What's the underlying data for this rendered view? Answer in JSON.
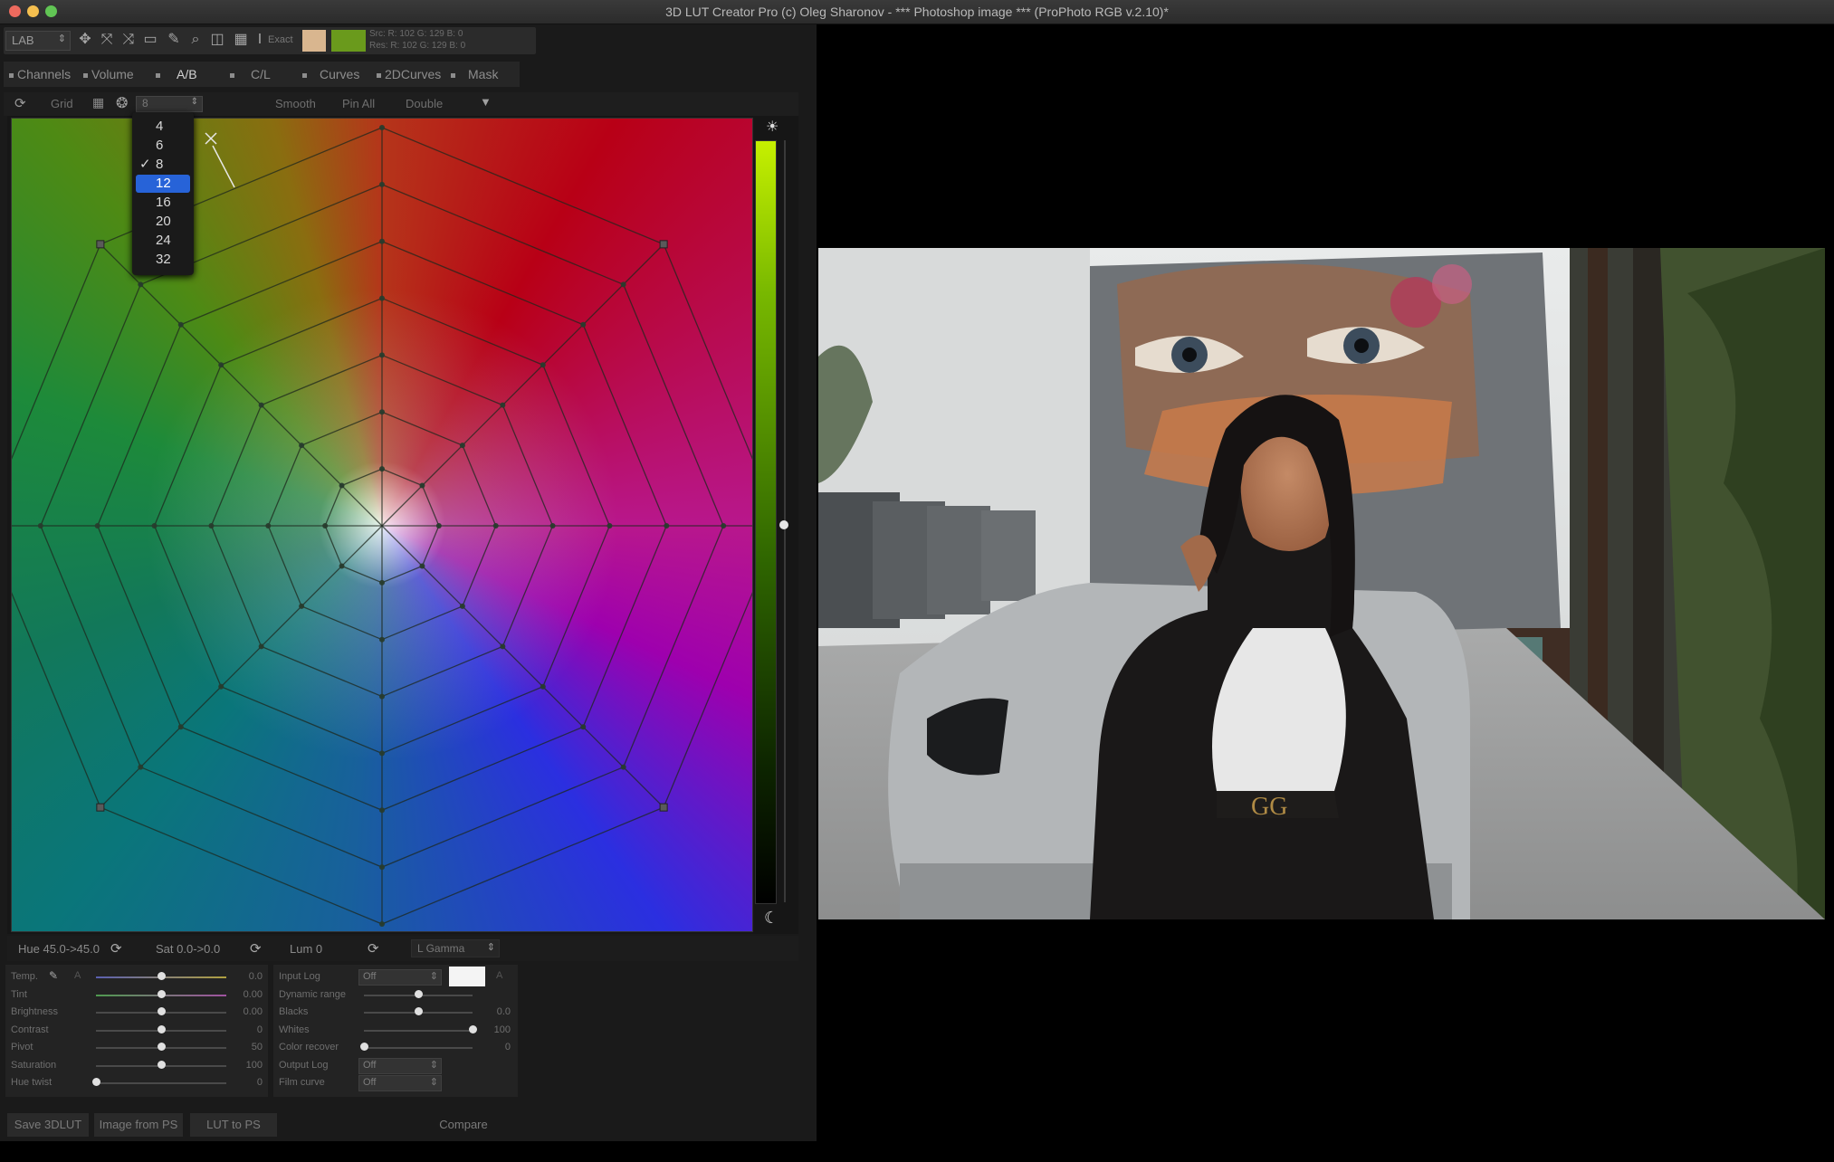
{
  "window": {
    "title": "3D LUT Creator Pro (c) Oleg Sharonov - *** Photoshop image *** (ProPhoto RGB v.2.10)*"
  },
  "toolbar": {
    "mode": "LAB",
    "exact_label": "Exact",
    "src_readout": "Src: R: 102  G: 129  B:  0",
    "res_readout": "Res: R: 102  G: 129  B:  0",
    "color_patch_1": "#d9b68f",
    "color_patch_2": "#6a9a1c"
  },
  "tabs": [
    {
      "label": "Channels"
    },
    {
      "label": "Volume"
    },
    {
      "label": "A/B"
    },
    {
      "label": "C/L"
    },
    {
      "label": "Curves"
    },
    {
      "label": "2DCurves"
    },
    {
      "label": "Mask"
    }
  ],
  "subtoolbar": {
    "grid_label": "Grid",
    "grid_value": "8",
    "smooth_label": "Smooth",
    "pin_all_label": "Pin All",
    "double_label": "Double"
  },
  "grid_dropdown": {
    "options": [
      "4",
      "6",
      "8",
      "12",
      "16",
      "20",
      "24",
      "32"
    ],
    "checked": "8",
    "highlighted": "12"
  },
  "graph": {
    "grid_size": 8,
    "rings": 7
  },
  "hue_row": {
    "hue": "Hue 45.0->45.0",
    "sat": "Sat 0.0->0.0",
    "lum": "Lum  0",
    "gamma": "L  Gamma"
  },
  "adjust_left": [
    {
      "label": "Temp.",
      "value": "0.0",
      "pos": 0.5
    },
    {
      "label": "Tint",
      "value": "0.00",
      "pos": 0.5
    },
    {
      "label": "Brightness",
      "value": "0.00",
      "pos": 0.5
    },
    {
      "label": "Contrast",
      "value": "0",
      "pos": 0.5
    },
    {
      "label": "Pivot",
      "value": "50",
      "pos": 0.5
    },
    {
      "label": "Saturation",
      "value": "100",
      "pos": 0.5
    },
    {
      "label": "Hue twist",
      "value": "0",
      "pos": 0.0
    }
  ],
  "adjust_right": [
    {
      "label": "Input Log",
      "type": "popup",
      "value": "Off"
    },
    {
      "label": "Dynamic range",
      "type": "slider",
      "pos": 0.5,
      "value": ""
    },
    {
      "label": "Blacks",
      "type": "slider",
      "pos": 0.5,
      "value": "0.0"
    },
    {
      "label": "Whites",
      "type": "slider",
      "pos": 1.0,
      "value": "100"
    },
    {
      "label": "Color recover",
      "type": "slider",
      "pos": 0.0,
      "value": "0"
    },
    {
      "label": "Output Log",
      "type": "popup",
      "value": "Off"
    },
    {
      "label": "Film curve",
      "type": "popup",
      "value": "Off"
    }
  ],
  "bottom_bar": {
    "save": "Save 3DLUT",
    "image_from_ps": "Image from PS",
    "lut_to_ps": "LUT to PS",
    "compare": "Compare"
  }
}
